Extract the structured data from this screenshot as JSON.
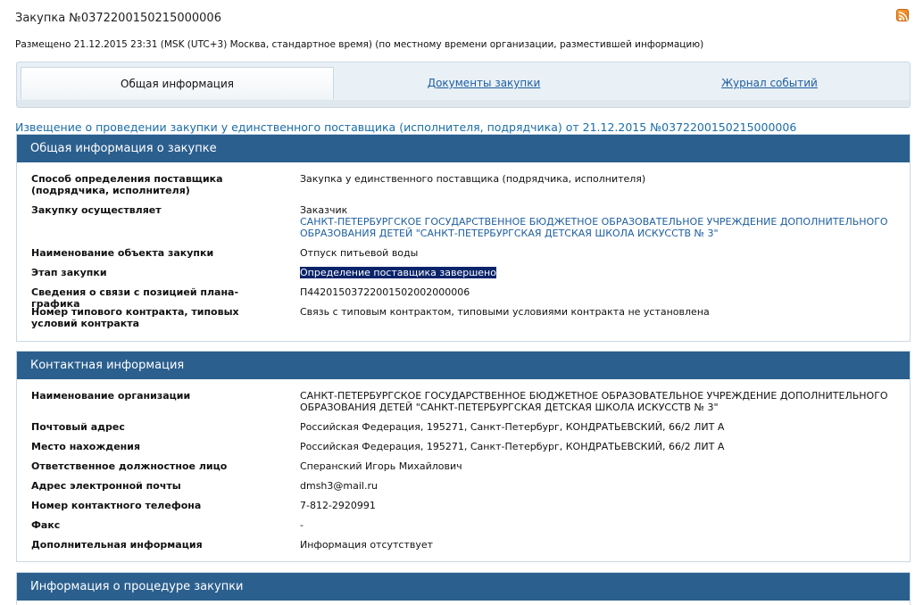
{
  "header": {
    "title": "Закупка №0372200150215000006",
    "posted": "Размещено 21.12.2015 23:31 (MSK (UTC+3) Москва, стандартное время) (по местному времени организации, разместившей информацию)"
  },
  "tabs": [
    {
      "label": "Общая информация"
    },
    {
      "label": "Документы закупки"
    },
    {
      "label": "Журнал событий"
    }
  ],
  "notice": "Извещение о проведении закупки у единственного поставщика (исполнителя, подрядчика) от 21.12.2015 №0372200150215000006",
  "general": {
    "header": "Общая информация о закупке",
    "rows": [
      {
        "label": "Способ определения поставщика (подрядчика, исполнителя)",
        "value": "Закупка у единственного поставщика (подрядчика, исполнителя)"
      },
      {
        "label": "Закупку осуществляет",
        "value_prefix": "Заказчик",
        "value": "САНКТ-ПЕТЕРБУРГСКОЕ ГОСУДАРСТВЕННОЕ БЮДЖЕТНОЕ ОБРАЗОВАТЕЛЬНОЕ УЧРЕЖДЕНИЕ ДОПОЛНИТЕЛЬНОГО ОБРАЗОВАНИЯ ДЕТЕЙ \"САНКТ-ПЕТЕРБУРГСКАЯ ДЕТСКАЯ ШКОЛА ИСКУССТВ № 3\""
      },
      {
        "label": "Наименование объекта закупки",
        "value": "Отпуск питьевой воды"
      },
      {
        "label": "Этап закупки",
        "value": "Определение поставщика завершено"
      },
      {
        "label": "Сведения о связи с позицией плана-графика",
        "value": "П44201503722001502002000006"
      },
      {
        "label": "Номер типового контракта, типовых условий контракта",
        "value": "Связь с типовым контрактом, типовыми условиями контракта не установлена"
      }
    ]
  },
  "contact": {
    "header": "Контактная информация",
    "rows": [
      {
        "label": "Наименование организации",
        "value": "САНКТ-ПЕТЕРБУРГСКОЕ ГОСУДАРСТВЕННОЕ БЮДЖЕТНОЕ ОБРАЗОВАТЕЛЬНОЕ УЧРЕЖДЕНИЕ ДОПОЛНИТЕЛЬНОГО ОБРАЗОВАНИЯ ДЕТЕЙ \"САНКТ-ПЕТЕРБУРГСКАЯ ДЕТСКАЯ ШКОЛА ИСКУССТВ № 3\""
      },
      {
        "label": "Почтовый адрес",
        "value": "Российская Федерация, 195271, Санкт-Петербург, КОНДРАТЬЕВСКИЙ, 66/2 ЛИТ А"
      },
      {
        "label": "Место нахождения",
        "value": "Российская Федерация, 195271, Санкт-Петербург, КОНДРАТЬЕВСКИЙ, 66/2 ЛИТ А"
      },
      {
        "label": "Ответственное должностное лицо",
        "value": "Сперанский Игорь Михайлович"
      },
      {
        "label": "Адрес электронной почты",
        "value": "dmsh3@mail.ru"
      },
      {
        "label": "Номер контактного телефона",
        "value": "7-812-2920991"
      },
      {
        "label": "Факс",
        "value": "-"
      },
      {
        "label": "Дополнительная информация",
        "value": "Информация отсутствует"
      }
    ]
  },
  "procedure": {
    "header": "Информация о процедуре закупки"
  },
  "icons": {
    "rss": "rss-icon"
  },
  "colors": {
    "section_header": "#2b5f8e",
    "link": "#1e5fa0",
    "notice": "#1b6da8",
    "selection": "#0a246a"
  }
}
